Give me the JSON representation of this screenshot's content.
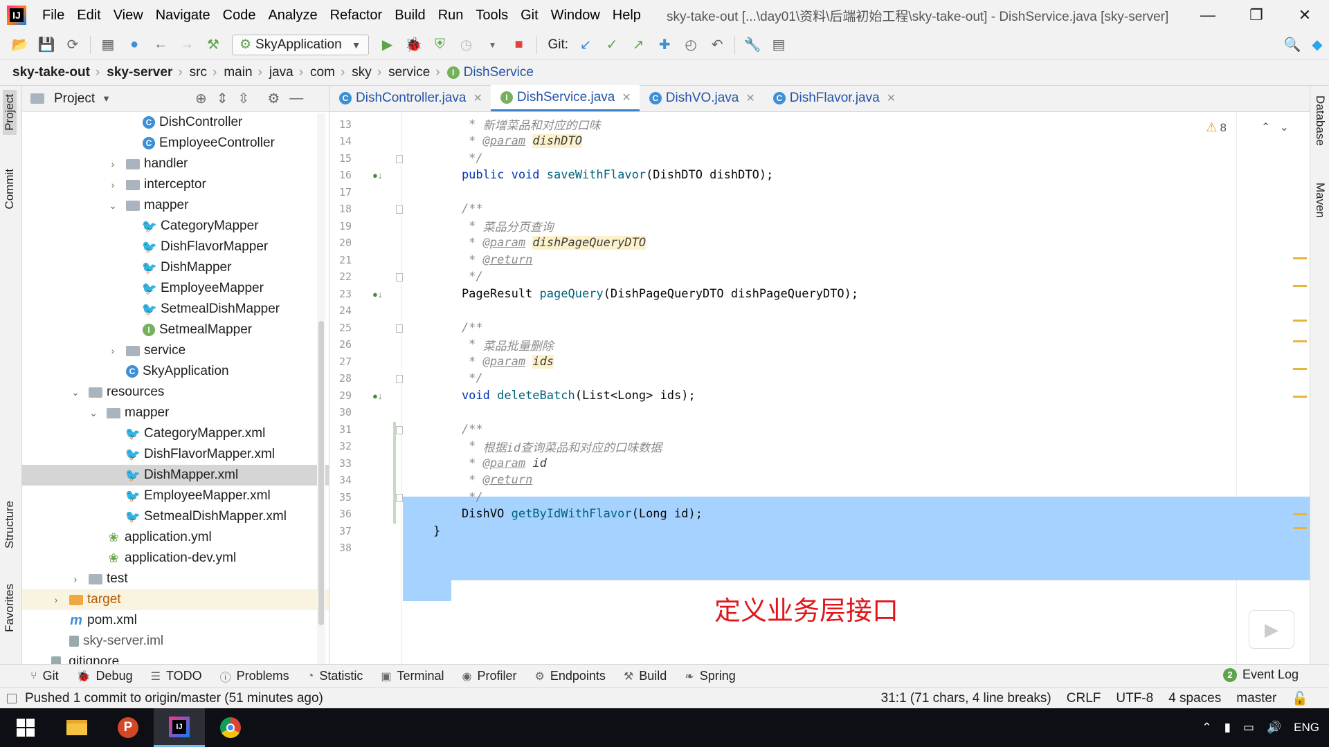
{
  "menubar": {
    "logo_text": "IJ",
    "items": [
      "File",
      "Edit",
      "View",
      "Navigate",
      "Code",
      "Analyze",
      "Refactor",
      "Build",
      "Run",
      "Tools",
      "Git",
      "Window",
      "Help"
    ],
    "window_title": "sky-take-out [...\\day01\\资料\\后端初始工程\\sky-take-out] - DishService.java [sky-server]",
    "minimize": "—",
    "restore": "❐",
    "close": "✕"
  },
  "toolbar": {
    "run_config": "SkyApplication",
    "git_label": "Git:"
  },
  "breadcrumb": [
    "sky-take-out",
    "sky-server",
    "src",
    "main",
    "java",
    "com",
    "sky",
    "service",
    "DishService"
  ],
  "left_strip": {
    "project": "Project",
    "commit": "Commit",
    "structure": "Structure",
    "favorites": "Favorites"
  },
  "right_strip": {
    "database": "Database",
    "maven": "Maven"
  },
  "project_panel": {
    "title": "Project",
    "tree": [
      {
        "label": "DishController",
        "icon": "class",
        "indent": 174,
        "caret": ""
      },
      {
        "label": "EmployeeController",
        "icon": "class",
        "indent": 174,
        "caret": ""
      },
      {
        "label": "handler",
        "icon": "folder",
        "indent": 150,
        "caret": "right"
      },
      {
        "label": "interceptor",
        "icon": "folder",
        "indent": 150,
        "caret": "right"
      },
      {
        "label": "mapper",
        "icon": "folder",
        "indent": 150,
        "caret": "down"
      },
      {
        "label": "CategoryMapper",
        "icon": "mybatis",
        "indent": 174,
        "caret": ""
      },
      {
        "label": "DishFlavorMapper",
        "icon": "mybatis",
        "indent": 174,
        "caret": ""
      },
      {
        "label": "DishMapper",
        "icon": "mybatis",
        "indent": 174,
        "caret": ""
      },
      {
        "label": "EmployeeMapper",
        "icon": "mybatis",
        "indent": 174,
        "caret": ""
      },
      {
        "label": "SetmealDishMapper",
        "icon": "mybatis",
        "indent": 174,
        "caret": ""
      },
      {
        "label": "SetmealMapper",
        "icon": "iface",
        "indent": 174,
        "caret": ""
      },
      {
        "label": "service",
        "icon": "folder",
        "indent": 150,
        "caret": "right"
      },
      {
        "label": "SkyApplication",
        "icon": "class",
        "indent": 150,
        "caret": ""
      },
      {
        "label": "resources",
        "icon": "folder",
        "indent": 96,
        "caret": "down"
      },
      {
        "label": "mapper",
        "icon": "folder",
        "indent": 122,
        "caret": "down"
      },
      {
        "label": "CategoryMapper.xml",
        "icon": "mybatis",
        "indent": 150,
        "caret": ""
      },
      {
        "label": "DishFlavorMapper.xml",
        "icon": "mybatis",
        "indent": 150,
        "caret": ""
      },
      {
        "label": "DishMapper.xml",
        "icon": "mybatis",
        "indent": 150,
        "caret": "",
        "selected": true
      },
      {
        "label": "EmployeeMapper.xml",
        "icon": "mybatis",
        "indent": 150,
        "caret": ""
      },
      {
        "label": "SetmealDishMapper.xml",
        "icon": "mybatis",
        "indent": 150,
        "caret": ""
      },
      {
        "label": "application.yml",
        "icon": "yml",
        "indent": 122,
        "caret": ""
      },
      {
        "label": "application-dev.yml",
        "icon": "yml",
        "indent": 122,
        "caret": ""
      },
      {
        "label": "test",
        "icon": "folder",
        "indent": 96,
        "caret": "right"
      },
      {
        "label": "target",
        "icon": "folder-orange",
        "indent": 68,
        "caret": "right",
        "highlight": true,
        "orange": true
      },
      {
        "label": "pom.xml",
        "icon": "maven",
        "indent": 68,
        "caret": ""
      },
      {
        "label": "sky-server.iml",
        "icon": "iml",
        "indent": 68,
        "caret": "",
        "muted": true
      },
      {
        "label": ".gitignore",
        "icon": "iml",
        "indent": 42,
        "caret": ""
      }
    ]
  },
  "editor_tabs": [
    {
      "label": "DishController.java",
      "icon": "class",
      "active": false
    },
    {
      "label": "DishService.java",
      "icon": "iface",
      "active": true
    },
    {
      "label": "DishVO.java",
      "icon": "class",
      "active": false
    },
    {
      "label": "DishFlavor.java",
      "icon": "class",
      "active": false
    }
  ],
  "editor": {
    "warning_count": "8",
    "annotation": "定义业务层接口",
    "lines": [
      {
        "no": "12",
        "parts": [
          {
            "t": "     */",
            "c": "c-comment"
          }
        ]
      },
      {
        "no": "13",
        "parts": [
          {
            "t": "     * ",
            "c": "c-comment"
          },
          {
            "t": "新增菜品和对应的口味",
            "c": "c-comment"
          }
        ]
      },
      {
        "no": "14",
        "parts": [
          {
            "t": "     * ",
            "c": "c-comment"
          },
          {
            "t": "@param",
            "c": "c-tag"
          },
          {
            "t": " ",
            "c": "c-comment"
          },
          {
            "t": "dishDTO",
            "c": "c-param"
          }
        ]
      },
      {
        "no": "15",
        "parts": [
          {
            "t": "     */",
            "c": "c-comment"
          }
        ]
      },
      {
        "no": "16",
        "parts": [
          {
            "t": "    public void ",
            "c": "c-kw"
          },
          {
            "t": "saveWithFlavor",
            "c": "c-method"
          },
          {
            "t": "(DishDTO dishDTO);",
            "c": "c-type"
          }
        ]
      },
      {
        "no": "17",
        "parts": []
      },
      {
        "no": "18",
        "parts": [
          {
            "t": "    /**",
            "c": "c-comment"
          }
        ]
      },
      {
        "no": "19",
        "parts": [
          {
            "t": "     * ",
            "c": "c-comment"
          },
          {
            "t": "菜品分页查询",
            "c": "c-comment"
          }
        ]
      },
      {
        "no": "20",
        "parts": [
          {
            "t": "     * ",
            "c": "c-comment"
          },
          {
            "t": "@param",
            "c": "c-tag"
          },
          {
            "t": " ",
            "c": "c-comment"
          },
          {
            "t": "dishPageQueryDTO",
            "c": "c-param"
          }
        ]
      },
      {
        "no": "21",
        "parts": [
          {
            "t": "     * ",
            "c": "c-comment"
          },
          {
            "t": "@return",
            "c": "c-tag"
          }
        ]
      },
      {
        "no": "22",
        "parts": [
          {
            "t": "     */",
            "c": "c-comment"
          }
        ]
      },
      {
        "no": "23",
        "parts": [
          {
            "t": "    PageResult ",
            "c": "c-type"
          },
          {
            "t": "pageQuery",
            "c": "c-method"
          },
          {
            "t": "(DishPageQueryDTO dishPageQueryDTO);",
            "c": "c-type"
          }
        ]
      },
      {
        "no": "24",
        "parts": []
      },
      {
        "no": "25",
        "parts": [
          {
            "t": "    /**",
            "c": "c-comment"
          }
        ]
      },
      {
        "no": "26",
        "parts": [
          {
            "t": "     * ",
            "c": "c-comment"
          },
          {
            "t": "菜品批量删除",
            "c": "c-comment"
          }
        ]
      },
      {
        "no": "27",
        "parts": [
          {
            "t": "     * ",
            "c": "c-comment"
          },
          {
            "t": "@param",
            "c": "c-tag"
          },
          {
            "t": " ",
            "c": "c-comment"
          },
          {
            "t": "ids",
            "c": "c-param"
          }
        ]
      },
      {
        "no": "28",
        "parts": [
          {
            "t": "     */",
            "c": "c-comment"
          }
        ]
      },
      {
        "no": "29",
        "parts": [
          {
            "t": "    void ",
            "c": "c-kw"
          },
          {
            "t": "deleteBatch",
            "c": "c-method"
          },
          {
            "t": "(List<Long> ids);",
            "c": "c-type"
          }
        ]
      },
      {
        "no": "30",
        "parts": []
      },
      {
        "no": "31",
        "parts": [
          {
            "t": "    /**",
            "c": "c-comment"
          }
        ]
      },
      {
        "no": "32",
        "parts": [
          {
            "t": "     * ",
            "c": "c-comment"
          },
          {
            "t": "根据id查询菜品和对应的口味数据",
            "c": "c-comment"
          }
        ]
      },
      {
        "no": "33",
        "parts": [
          {
            "t": "     * ",
            "c": "c-comment"
          },
          {
            "t": "@param",
            "c": "c-tag"
          },
          {
            "t": " ",
            "c": "c-comment"
          },
          {
            "t": "id",
            "c": "c-param-plain"
          }
        ]
      },
      {
        "no": "34",
        "parts": [
          {
            "t": "     * ",
            "c": "c-comment"
          },
          {
            "t": "@return",
            "c": "c-tag"
          }
        ]
      },
      {
        "no": "35",
        "parts": [
          {
            "t": "     */",
            "c": "c-comment"
          }
        ]
      },
      {
        "no": "36",
        "parts": [
          {
            "t": "    DishVO ",
            "c": "c-type"
          },
          {
            "t": "getByIdWithFlavor",
            "c": "c-method"
          },
          {
            "t": "(Long id);",
            "c": "c-type"
          }
        ]
      },
      {
        "no": "37",
        "parts": [
          {
            "t": "}",
            "c": "c-type"
          }
        ]
      },
      {
        "no": "38",
        "parts": []
      }
    ]
  },
  "bottom_tools": [
    "Git",
    "Debug",
    "TODO",
    "Problems",
    "Statistic",
    "Terminal",
    "Profiler",
    "Endpoints",
    "Build",
    "Spring"
  ],
  "event_log": {
    "count": "2",
    "label": "Event Log"
  },
  "statusbar": {
    "message": "Pushed 1 commit to origin/master (51 minutes ago)",
    "position": "31:1 (71 chars, 4 line breaks)",
    "line_sep": "CRLF",
    "encoding": "UTF-8",
    "indent": "4 spaces",
    "branch": "master"
  },
  "taskbar": {
    "lang": "ENG"
  }
}
